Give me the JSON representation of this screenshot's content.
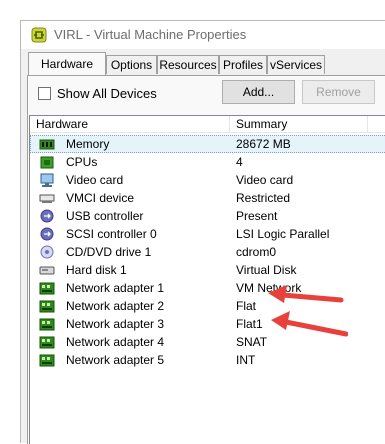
{
  "window": {
    "title": "VIRL - Virtual Machine Properties"
  },
  "tabs": [
    {
      "label": "Hardware",
      "active": true
    },
    {
      "label": "Options"
    },
    {
      "label": "Resources"
    },
    {
      "label": "Profiles"
    },
    {
      "label": "vServices"
    }
  ],
  "toolbar": {
    "show_all_label": "Show All Devices",
    "show_all_checked": false,
    "add_label": "Add...",
    "remove_label": "Remove"
  },
  "list": {
    "columns": [
      "Hardware",
      "Summary"
    ],
    "rows": [
      {
        "icon": "memory-icon",
        "name": "Memory",
        "summary": "28672 MB",
        "selected": true
      },
      {
        "icon": "cpu-icon",
        "name": "CPUs",
        "summary": "4"
      },
      {
        "icon": "video-card-icon",
        "name": "Video card",
        "summary": "Video card"
      },
      {
        "icon": "vmci-device-icon",
        "name": "VMCI device",
        "summary": "Restricted"
      },
      {
        "icon": "usb-controller-icon",
        "name": "USB controller",
        "summary": "Present"
      },
      {
        "icon": "scsi-controller-icon",
        "name": "SCSI controller 0",
        "summary": "LSI Logic Parallel"
      },
      {
        "icon": "cd-dvd-icon",
        "name": "CD/DVD drive 1",
        "summary": "cdrom0"
      },
      {
        "icon": "hard-disk-icon",
        "name": "Hard disk 1",
        "summary": "Virtual Disk"
      },
      {
        "icon": "network-adapter-icon",
        "name": "Network adapter 1",
        "summary": "VM Network"
      },
      {
        "icon": "network-adapter-icon",
        "name": "Network adapter 2",
        "summary": "Flat",
        "highlighted": true
      },
      {
        "icon": "network-adapter-icon",
        "name": "Network adapter 3",
        "summary": "Flat1",
        "highlighted": true
      },
      {
        "icon": "network-adapter-icon",
        "name": "Network adapter 4",
        "summary": "SNAT"
      },
      {
        "icon": "network-adapter-icon",
        "name": "Network adapter 5",
        "summary": "INT"
      }
    ]
  },
  "annotations": {
    "arrow_color": "#e8413b"
  },
  "colors": {
    "selection": "#e5f3fb",
    "nic_green": "#2e8b1a"
  }
}
